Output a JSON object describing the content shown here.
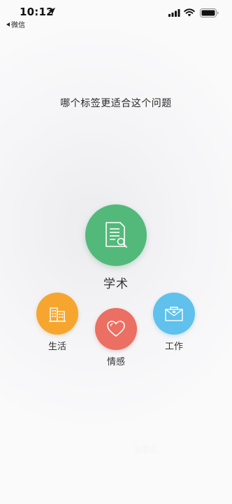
{
  "status_bar": {
    "time": "10:12",
    "back_label": "微信"
  },
  "prompt": {
    "question": "哪个标签更适合这个问题"
  },
  "categories": [
    {
      "label": "学术",
      "color": "#53b97a",
      "icon": "document-search-icon"
    },
    {
      "label": "生活",
      "color": "#f6a62f",
      "icon": "buildings-icon"
    },
    {
      "label": "情感",
      "color": "#ec6f63",
      "icon": "heart-icon"
    },
    {
      "label": "工作",
      "color": "#5fc1ec",
      "icon": "briefcase-icon"
    }
  ],
  "watermark": "360",
  "colors": {
    "background": "#f5f5f7",
    "text": "#333333"
  }
}
